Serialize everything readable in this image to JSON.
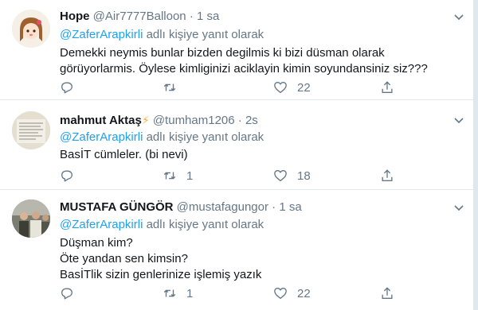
{
  "tweets": [
    {
      "name": "Hope",
      "handle": "@Air7777Balloon",
      "sep": "·",
      "time": "1 sa",
      "mention": "@ZaferArapkirli",
      "reply_suffix": " adlı kişiye yanıt olarak",
      "text_lines": [
        "Demekki neymis bunlar bizden degilmis ki bizi düsman olarak",
        "görüyorlarmis. Öylese kimliginizi aciklayin kimin soyundansiniz siz???"
      ],
      "retweets": "",
      "likes": "22"
    },
    {
      "name": "mahmut Aktaş",
      "name_emoji": "⚡",
      "handle": "@tumham1206",
      "sep": "·",
      "time": "2s",
      "mention": "@ZaferArapkirli",
      "reply_suffix": " adlı kişiye yanıt olarak",
      "text_lines": [
        "BasİT cümleler. (bi nevi)"
      ],
      "retweets": "1",
      "likes": "18"
    },
    {
      "name": "MUSTAFA GÜNGÖR",
      "handle": "@mustafagungor",
      "sep": "·",
      "time": "1 sa",
      "mention": "@ZaferArapkirli",
      "reply_suffix": " adlı kişiye yanıt olarak",
      "text_lines": [
        "Düşman kim?",
        "Öte yandan sen kimsin?",
        "BasİTlik sizin genlerinize işlemiş yazık"
      ],
      "retweets": "1",
      "likes": "22"
    }
  ],
  "colors": {
    "accent": "#1da1f2",
    "muted": "#657786",
    "text": "#14171a",
    "border": "#e1e8ed"
  },
  "icons": [
    "reply-icon",
    "retweet-icon",
    "like-icon",
    "share-icon",
    "chevron-down-icon"
  ]
}
